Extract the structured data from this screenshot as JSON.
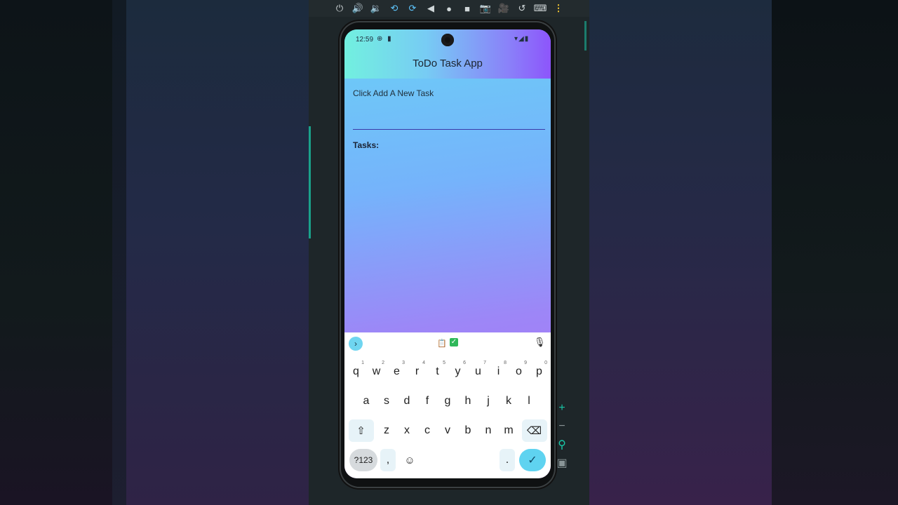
{
  "status_bar": {
    "time": "12:59",
    "left_icons": "⊕ ▮",
    "right_icons": "▾◢▮"
  },
  "app": {
    "title": "ToDo Task App",
    "input_label": "Click Add A New Task",
    "input_value": "",
    "tasks_heading": "Tasks:",
    "tasks": []
  },
  "keyboard": {
    "row1": [
      {
        "k": "q",
        "h": "1"
      },
      {
        "k": "w",
        "h": "2"
      },
      {
        "k": "e",
        "h": "3"
      },
      {
        "k": "r",
        "h": "4"
      },
      {
        "k": "t",
        "h": "5"
      },
      {
        "k": "y",
        "h": "6"
      },
      {
        "k": "u",
        "h": "7"
      },
      {
        "k": "i",
        "h": "8"
      },
      {
        "k": "o",
        "h": "9"
      },
      {
        "k": "p",
        "h": "0"
      }
    ],
    "row2": [
      "a",
      "s",
      "d",
      "f",
      "g",
      "h",
      "j",
      "k",
      "l"
    ],
    "row3": [
      "z",
      "x",
      "c",
      "v",
      "b",
      "n",
      "m"
    ],
    "shift": "⇧",
    "backspace": "⌫",
    "symbols": "?123",
    "comma": ",",
    "emoji": "☺",
    "period": ".",
    "enter": "✓",
    "expand": "›",
    "mic": "🎙",
    "clipboard": "📋",
    "check": "✓"
  },
  "colors": {
    "appbar_start": "#72f0df",
    "appbar_end": "#8d55fb",
    "body_top": "#6bd0f6",
    "body_bottom": "#b56cf8",
    "input_underline": "#3b3aa8",
    "keyboard_accent": "#5fd3f0"
  },
  "emulator": {
    "toolbar": [
      {
        "name": "power-icon",
        "glyph": "⏻"
      },
      {
        "name": "volume-up-icon",
        "glyph": "🔊"
      },
      {
        "name": "volume-down-icon",
        "glyph": "🔉"
      },
      {
        "name": "rotate-left-icon",
        "glyph": "⟲"
      },
      {
        "name": "rotate-right-icon",
        "glyph": "⟳"
      },
      {
        "name": "back-icon",
        "glyph": "◀"
      },
      {
        "name": "home-icon",
        "glyph": "●"
      },
      {
        "name": "overview-icon",
        "glyph": "■"
      },
      {
        "name": "screenshot-icon",
        "glyph": "📷"
      },
      {
        "name": "record-icon",
        "glyph": "🎥"
      },
      {
        "name": "snapshot-icon",
        "glyph": "↺"
      },
      {
        "name": "controller-icon",
        "glyph": "⌨"
      },
      {
        "name": "more-menu-icon",
        "glyph": "⋮"
      }
    ],
    "side_tools": [
      {
        "name": "zoom-in-icon",
        "glyph": "+"
      },
      {
        "name": "zoom-out-icon",
        "glyph": "−"
      },
      {
        "name": "zoom-search-icon",
        "glyph": "⚲"
      },
      {
        "name": "fit-screen-icon",
        "glyph": "▣"
      }
    ]
  }
}
